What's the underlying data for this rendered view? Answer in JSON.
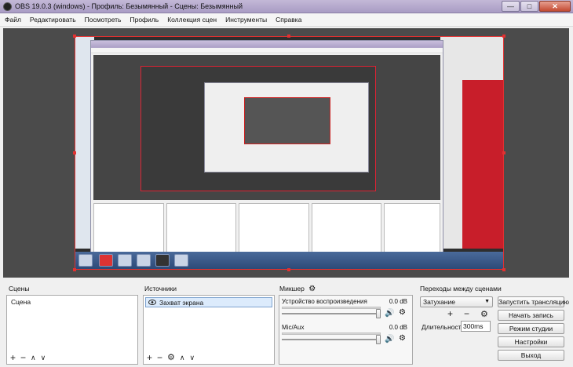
{
  "window": {
    "title": "OBS 19.0.3 (windows) - Профиль: Безымянный - Сцены: Безымянный",
    "minimize": "—",
    "maximize": "□",
    "close": "✕"
  },
  "menu": [
    "Файл",
    "Редактировать",
    "Посмотреть",
    "Профиль",
    "Коллекция сцен",
    "Инструменты",
    "Справка"
  ],
  "scenes": {
    "label": "Сцены",
    "items": [
      "Сцена"
    ],
    "add": "+",
    "remove": "−",
    "up": "∧",
    "down": "∨"
  },
  "sources": {
    "label": "Источники",
    "items": [
      {
        "icon": "eye-icon",
        "name": "Захват экрана"
      }
    ],
    "add": "+",
    "remove": "−",
    "settings": "⚙",
    "up": "∧",
    "down": "∨"
  },
  "mixer": {
    "label": "Микшер",
    "channels": [
      {
        "name": "Устройство воспроизведения",
        "db": "0.0 dB",
        "volume": 1.0
      },
      {
        "name": "Mic/Aux",
        "db": "0.0 dB",
        "volume": 1.0
      }
    ]
  },
  "transitions": {
    "label": "Переходы между сценами",
    "selected": "Затухание",
    "add": "+",
    "remove": "−",
    "duration_label": "Длительность",
    "duration_value": "300ms"
  },
  "controls": {
    "start_stream": "Запустить трансляцию",
    "start_record": "Начать запись",
    "studio_mode": "Режим студии",
    "settings": "Настройки",
    "exit": "Выход"
  },
  "colors": {
    "accent_selection": "#e23131",
    "titlebar": "#b3a8cd"
  }
}
